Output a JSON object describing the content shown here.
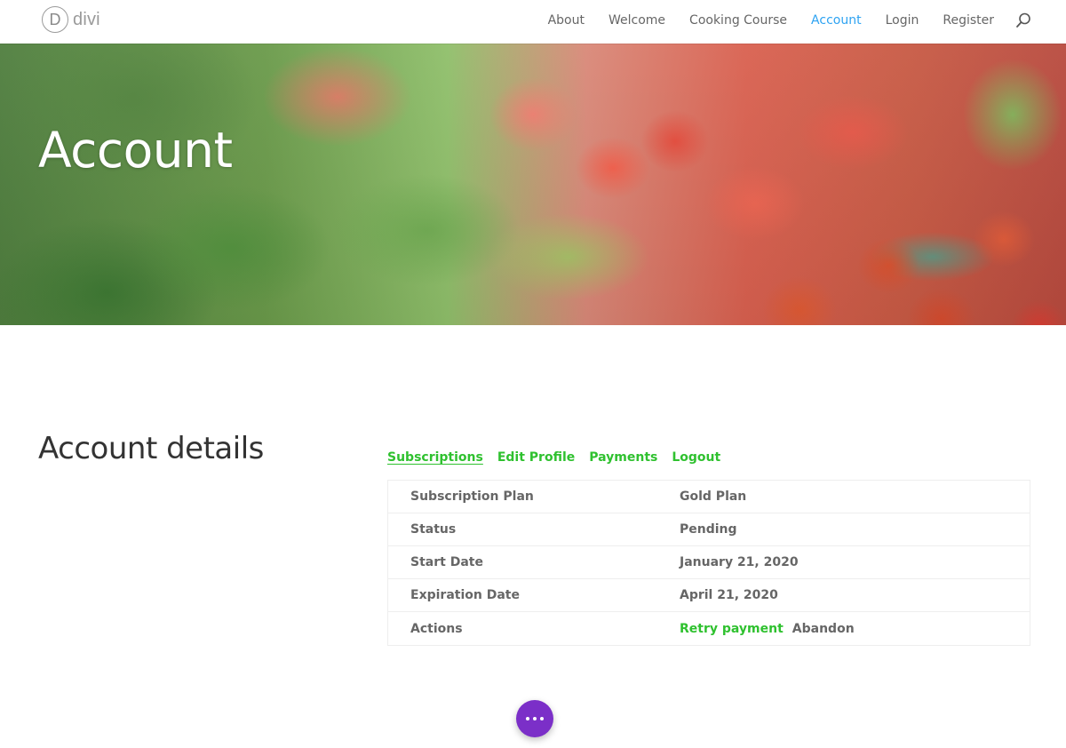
{
  "header": {
    "logo_letter": "D",
    "logo_text": "divi",
    "nav": [
      {
        "label": "About",
        "active": false
      },
      {
        "label": "Welcome",
        "active": false
      },
      {
        "label": "Cooking Course",
        "active": false
      },
      {
        "label": "Account",
        "active": true
      },
      {
        "label": "Login",
        "active": false
      },
      {
        "label": "Register",
        "active": false
      }
    ],
    "search_icon": "search-icon"
  },
  "hero": {
    "title": "Account"
  },
  "account": {
    "section_title": "Account details",
    "tabs": [
      {
        "label": "Subscriptions",
        "active": true
      },
      {
        "label": "Edit Profile",
        "active": false
      },
      {
        "label": "Payments",
        "active": false
      },
      {
        "label": "Logout",
        "active": false
      }
    ],
    "rows": [
      {
        "label": "Subscription Plan",
        "value": "Gold Plan"
      },
      {
        "label": "Status",
        "value": "Pending"
      },
      {
        "label": "Start Date",
        "value": "January 21, 2020"
      },
      {
        "label": "Expiration Date",
        "value": "April 21, 2020"
      },
      {
        "label": "Actions",
        "actions": [
          "Retry payment",
          "Abandon"
        ]
      }
    ]
  },
  "colors": {
    "accent_nav": "#2ea3f2",
    "link_green": "#2fc12f",
    "fab_purple": "#7b2fc8"
  },
  "fab_icon": "more-dots-icon"
}
